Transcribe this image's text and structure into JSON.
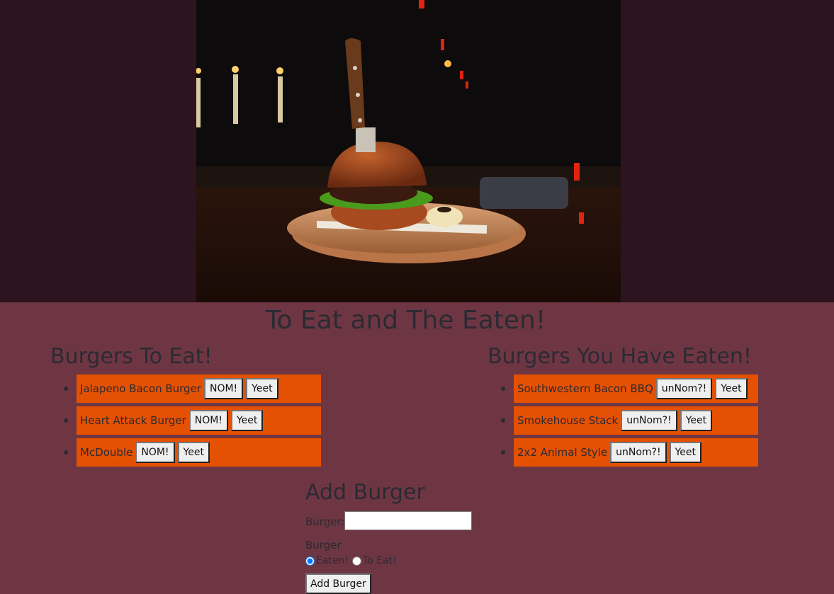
{
  "header": {
    "title": "To Eat and The Eaten!"
  },
  "to_eat": {
    "title": "Burgers To Eat!",
    "items": [
      {
        "name": "Jalapeno Bacon Burger",
        "action": "NOM!",
        "delete": "Yeet"
      },
      {
        "name": "Heart Attack Burger",
        "action": "NOM!",
        "delete": "Yeet"
      },
      {
        "name": "McDouble",
        "action": "NOM!",
        "delete": "Yeet"
      }
    ]
  },
  "eaten": {
    "title": "Burgers You Have Eaten!",
    "items": [
      {
        "name": "Southwestern Bacon BBQ",
        "action": "unNom?!",
        "delete": "Yeet"
      },
      {
        "name": "Smokehouse Stack",
        "action": "unNom?!",
        "delete": "Yeet"
      },
      {
        "name": "2x2 Animal Style",
        "action": "unNom?!",
        "delete": "Yeet"
      }
    ]
  },
  "form": {
    "title": "Add Burger",
    "burger_label": "Burger:",
    "burger_value": "",
    "radio_heading": "Burger",
    "radio_eaten": "Eaten!",
    "radio_to_eat": "To Eat!",
    "radio_selected": "eaten",
    "submit": "Add Burger"
  },
  "colors": {
    "page_bg": "#6e3643",
    "hero_bg": "#2e141f",
    "item_bg": "#e55102",
    "text": "#2b2a33"
  },
  "hero": {
    "image": "burger-on-wooden-board-photo"
  }
}
